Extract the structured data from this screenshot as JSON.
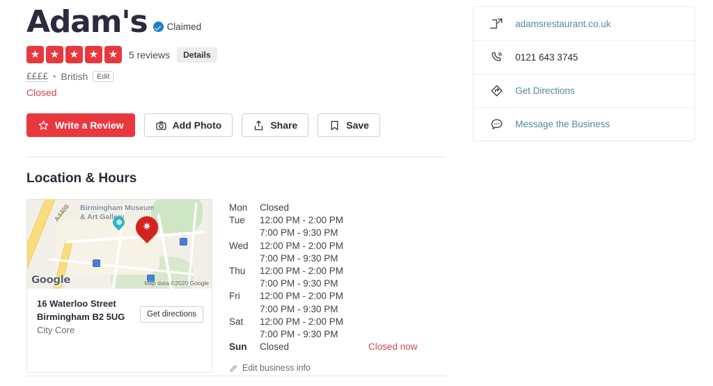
{
  "business": {
    "name": "Adam's",
    "claimed_label": "Claimed",
    "claimed_badge_icon": "verified-check-icon",
    "rating": 5,
    "star_icon": "star-icon",
    "reviews_label": "5 reviews",
    "details_button": "Details",
    "price_range": "££££",
    "separator": "•",
    "category": "British",
    "edit_button": "Edit",
    "open_status": "Closed"
  },
  "actions": [
    {
      "label": "Write a Review",
      "icon": "star-outline-icon",
      "style": "primary"
    },
    {
      "label": "Add Photo",
      "icon": "camera-icon",
      "style": "default"
    },
    {
      "label": "Share",
      "icon": "share-icon",
      "style": "default"
    },
    {
      "label": "Save",
      "icon": "bookmark-icon",
      "style": "default"
    }
  ],
  "location_hours": {
    "section_title": "Location & Hours",
    "map": {
      "poi_label": "Birmingham Museum\n& Art Gallery",
      "road_label": "A4400",
      "provider_logo": "Google",
      "attribution": "Map data ©2020 Google",
      "pin_icon": "yelp-pin-icon"
    },
    "address": {
      "line1": "16 Waterloo Street",
      "line2": "Birmingham B2 5UG",
      "neighborhood": "City Core",
      "get_directions_button": "Get directions"
    },
    "hours": [
      {
        "day": "Mon",
        "times": [
          "Closed"
        ],
        "today": false,
        "note": ""
      },
      {
        "day": "Tue",
        "times": [
          "12:00 PM - 2:00 PM",
          "7:00 PM - 9:30 PM"
        ],
        "today": false,
        "note": ""
      },
      {
        "day": "Wed",
        "times": [
          "12:00 PM - 2:00 PM",
          "7:00 PM - 9:30 PM"
        ],
        "today": false,
        "note": ""
      },
      {
        "day": "Thu",
        "times": [
          "12:00 PM - 2:00 PM",
          "7:00 PM - 9:30 PM"
        ],
        "today": false,
        "note": ""
      },
      {
        "day": "Fri",
        "times": [
          "12:00 PM - 2:00 PM",
          "7:00 PM - 9:30 PM"
        ],
        "today": false,
        "note": ""
      },
      {
        "day": "Sat",
        "times": [
          "12:00 PM - 2:00 PM",
          "7:00 PM - 9:30 PM"
        ],
        "today": false,
        "note": ""
      },
      {
        "day": "Sun",
        "times": [
          "Closed"
        ],
        "today": true,
        "note": "Closed now"
      }
    ],
    "edit_business_info": "Edit business info",
    "edit_icon": "pencil-icon"
  },
  "sidebar": {
    "rows": [
      {
        "label": "adamsrestaurant.co.uk",
        "icon": "external-link-icon",
        "style": "link"
      },
      {
        "label": "0121 643 3745",
        "icon": "phone-icon",
        "style": "plain"
      },
      {
        "label": "Get Directions",
        "icon": "directions-icon",
        "style": "link"
      },
      {
        "label": "Message the Business",
        "icon": "message-bubble-icon",
        "style": "link"
      }
    ]
  },
  "colors": {
    "brand_red": "#e8383e",
    "link_teal": "#4e8c9c",
    "status_red": "#d0494d",
    "claimed_blue": "#1d7ec4",
    "title_navy": "#2b2a3f"
  }
}
